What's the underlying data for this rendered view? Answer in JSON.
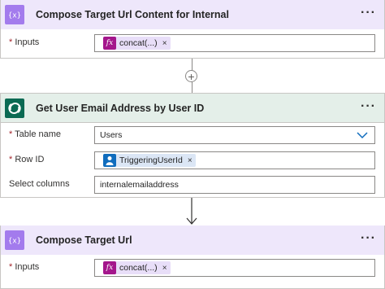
{
  "card1": {
    "title": "Compose Target Url Content for Internal",
    "inputs_label": "Inputs",
    "required_mark": "*",
    "token_text": "concat(...)",
    "remove_symbol": "×"
  },
  "card2": {
    "title": "Get User Email Address by User ID",
    "table_label": "Table name",
    "table_value": "Users",
    "rowid_label": "Row ID",
    "rowid_token": "TriggeringUserId",
    "select_label": "Select columns",
    "select_value": "internalemailaddress",
    "required_mark": "*",
    "remove_symbol": "×"
  },
  "card3": {
    "title": "Compose Target Url",
    "inputs_label": "Inputs",
    "required_mark": "*",
    "token_text": "concat(...)",
    "remove_symbol": "×"
  },
  "menu_symbol": "···",
  "add_symbol": "+",
  "fx_symbol": "fx",
  "colors": {
    "compose_accent": "#a37bed",
    "dataverse_accent": "#0b6a53",
    "expression_token": "#a4168c",
    "dynamic_token": "#0f6cbd",
    "required": "#a4262c"
  },
  "icons": [
    "compose-icon",
    "dataverse-icon",
    "expression-fx-icon",
    "user-icon",
    "chevron-down-icon",
    "more-options-icon",
    "add-step-icon",
    "arrow-down-icon"
  ]
}
